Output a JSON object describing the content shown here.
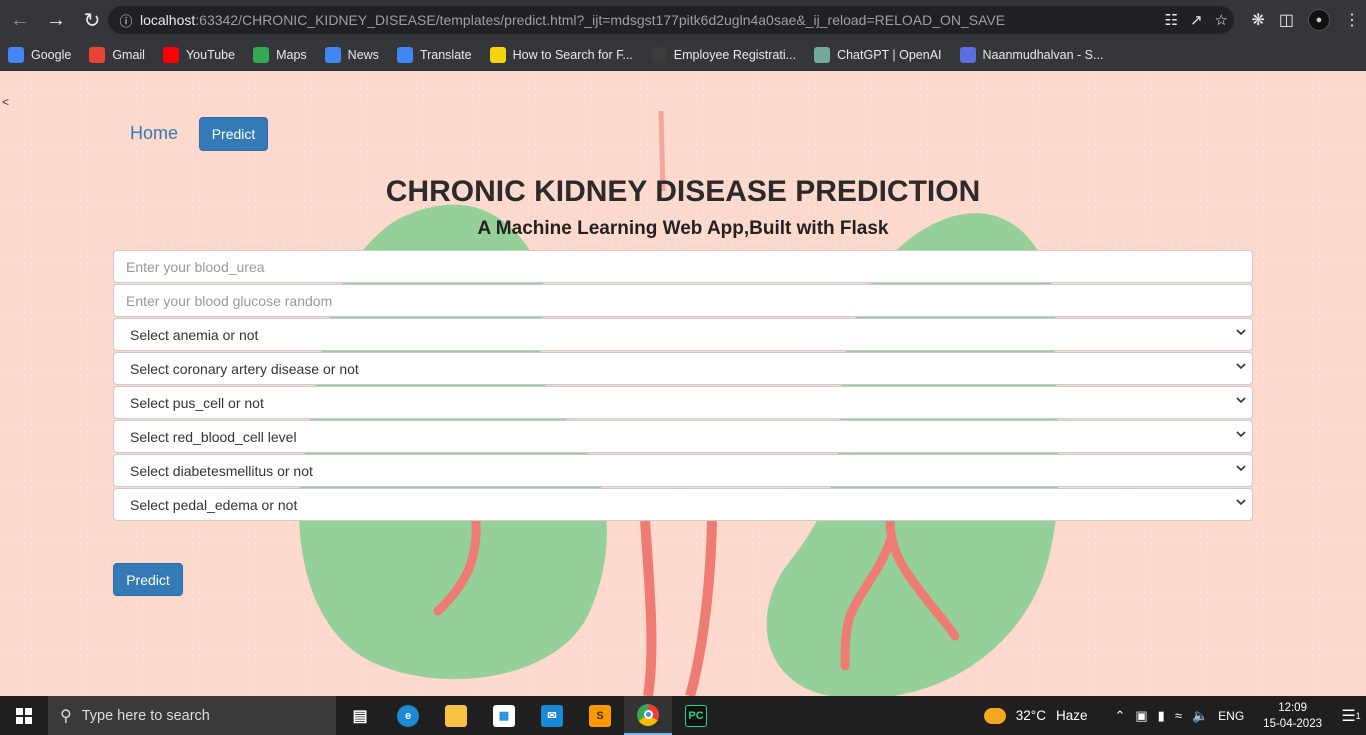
{
  "browser": {
    "url_host": "localhost",
    "url_rest": ":63342/CHRONIC_KIDNEY_DISEASE/templates/predict.html?_ijt=mdsgst177pitk6d2ugln4a0sae&_ij_reload=RELOAD_ON_SAVE",
    "bookmarks": [
      {
        "label": "Google",
        "icon": "google-icon",
        "color": "#4285f4"
      },
      {
        "label": "Gmail",
        "icon": "gmail-icon",
        "color": "#ea4335"
      },
      {
        "label": "YouTube",
        "icon": "youtube-icon",
        "color": "#ff0000"
      },
      {
        "label": "Maps",
        "icon": "maps-icon",
        "color": "#34a853"
      },
      {
        "label": "News",
        "icon": "news-icon",
        "color": "#4285f4"
      },
      {
        "label": "Translate",
        "icon": "translate-icon",
        "color": "#4285f4"
      },
      {
        "label": "How to Search for F...",
        "icon": "dictionary-icon",
        "color": "#f5d60d"
      },
      {
        "label": "Employee Registrati...",
        "icon": "page-icon",
        "color": "#3b3b3b"
      },
      {
        "label": "ChatGPT | OpenAI",
        "icon": "chatgpt-icon",
        "color": "#74aa9c"
      },
      {
        "label": "Naanmudhalvan - S...",
        "icon": "site-icon",
        "color": "#5b6ee1"
      }
    ]
  },
  "page": {
    "stray_char": "<",
    "nav": {
      "home": "Home",
      "predict": "Predict"
    },
    "title": "CHRONIC KIDNEY DISEASE PREDICTION",
    "subtitle": "A Machine Learning Web App,Built with Flask",
    "inputs": [
      {
        "placeholder": "Enter your blood_urea"
      },
      {
        "placeholder": "Enter your blood glucose random"
      }
    ],
    "selects": [
      {
        "value": "Select anemia or not"
      },
      {
        "value": "Select coronary artery disease or not"
      },
      {
        "value": "Select pus_cell or not"
      },
      {
        "value": "Select red_blood_cell level"
      },
      {
        "value": "Select diabetesmellitus or not"
      },
      {
        "value": "Select pedal_edema or not"
      }
    ],
    "submit": "Predict",
    "colors": {
      "accent": "#337ab7",
      "background": "#fcd9cc",
      "kidney": "#95d09a",
      "vessel": "#ee7c72"
    }
  },
  "taskbar": {
    "search_placeholder": "Type here to search",
    "weather": {
      "temp": "32°C",
      "desc": "Haze"
    },
    "lang": "ENG",
    "time": "12:09",
    "date": "15-04-2023",
    "notifications": "1"
  }
}
